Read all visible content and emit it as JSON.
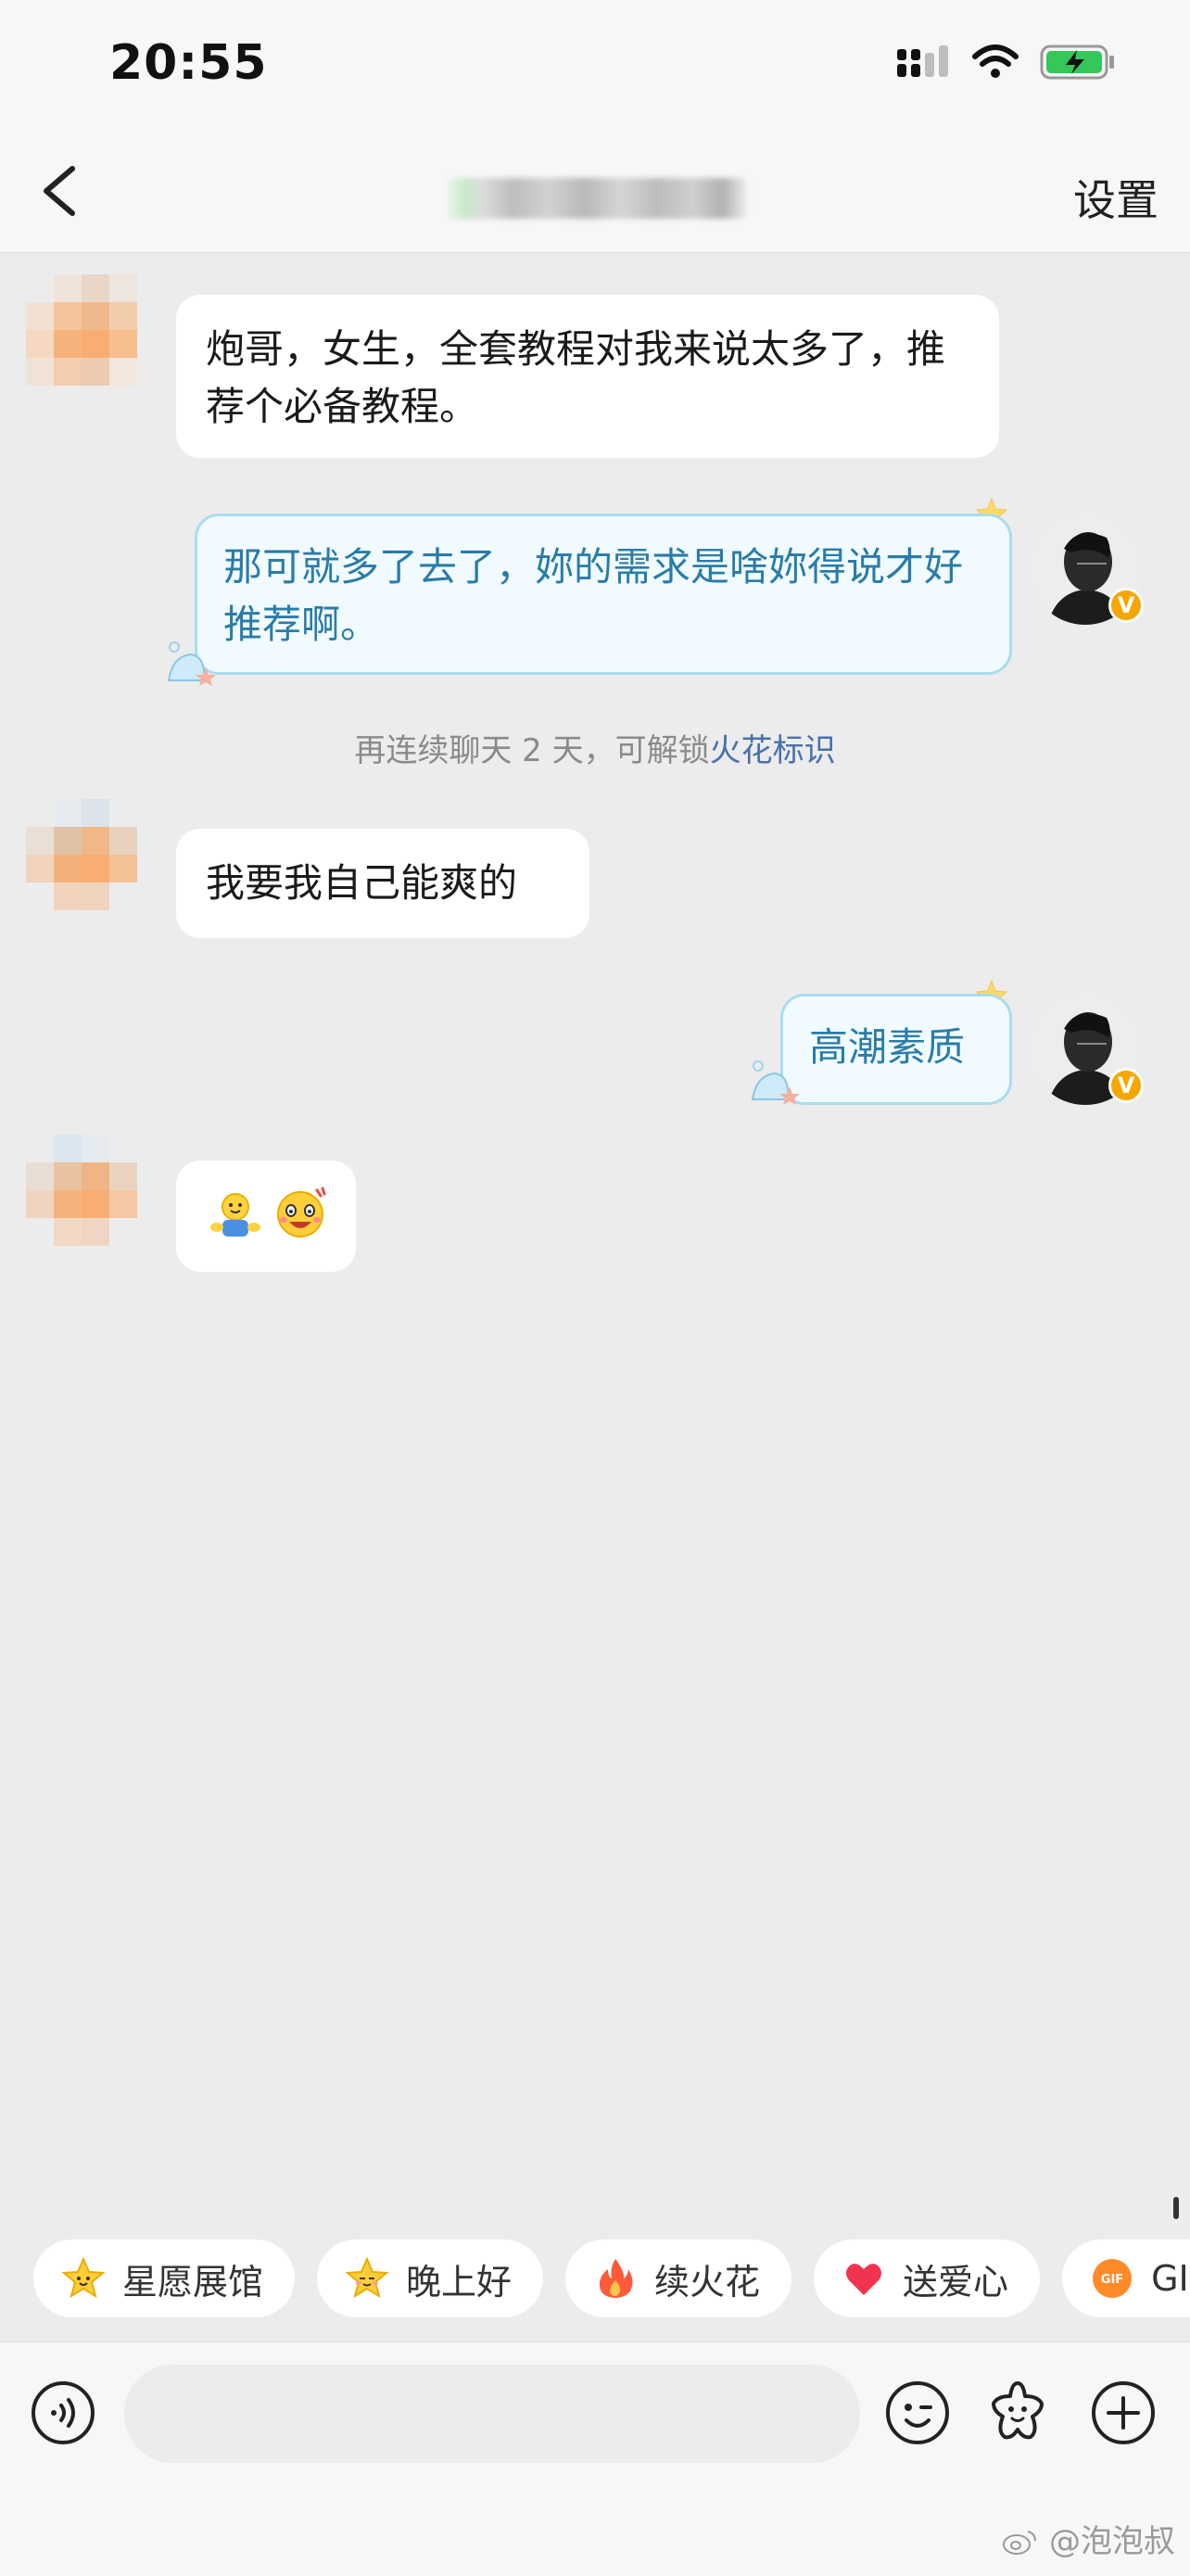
{
  "status_bar": {
    "time": "20:55"
  },
  "nav": {
    "settings_label": "设置"
  },
  "messages": {
    "m1": "炮哥，女生，全套教程对我来说太多了，推荐个必备教程。",
    "m2": "那可就多了去了，妳的需求是啥妳得说才好推荐啊。",
    "system_prefix": "再连续聊天 2 天，可解锁",
    "system_link": "火花标识",
    "m3": "我要我自己能爽的",
    "m4": "高潮素质"
  },
  "quick_replies": [
    {
      "label": "星愿展馆",
      "icon": "star-face-icon"
    },
    {
      "label": "晚上好",
      "icon": "star-face-icon"
    },
    {
      "label": "续火花",
      "icon": "flame-icon"
    },
    {
      "label": "送爱心",
      "icon": "heart-icon"
    },
    {
      "label": "GIF",
      "icon": "gif-icon"
    }
  ],
  "colors": {
    "background": "#ececec",
    "my_bubble_text": "#2a7ca8",
    "my_bubble_border": "#a9dcef",
    "link": "#4a6fae",
    "verified_badge": "#f5a700"
  },
  "watermark": "@泡泡叔"
}
